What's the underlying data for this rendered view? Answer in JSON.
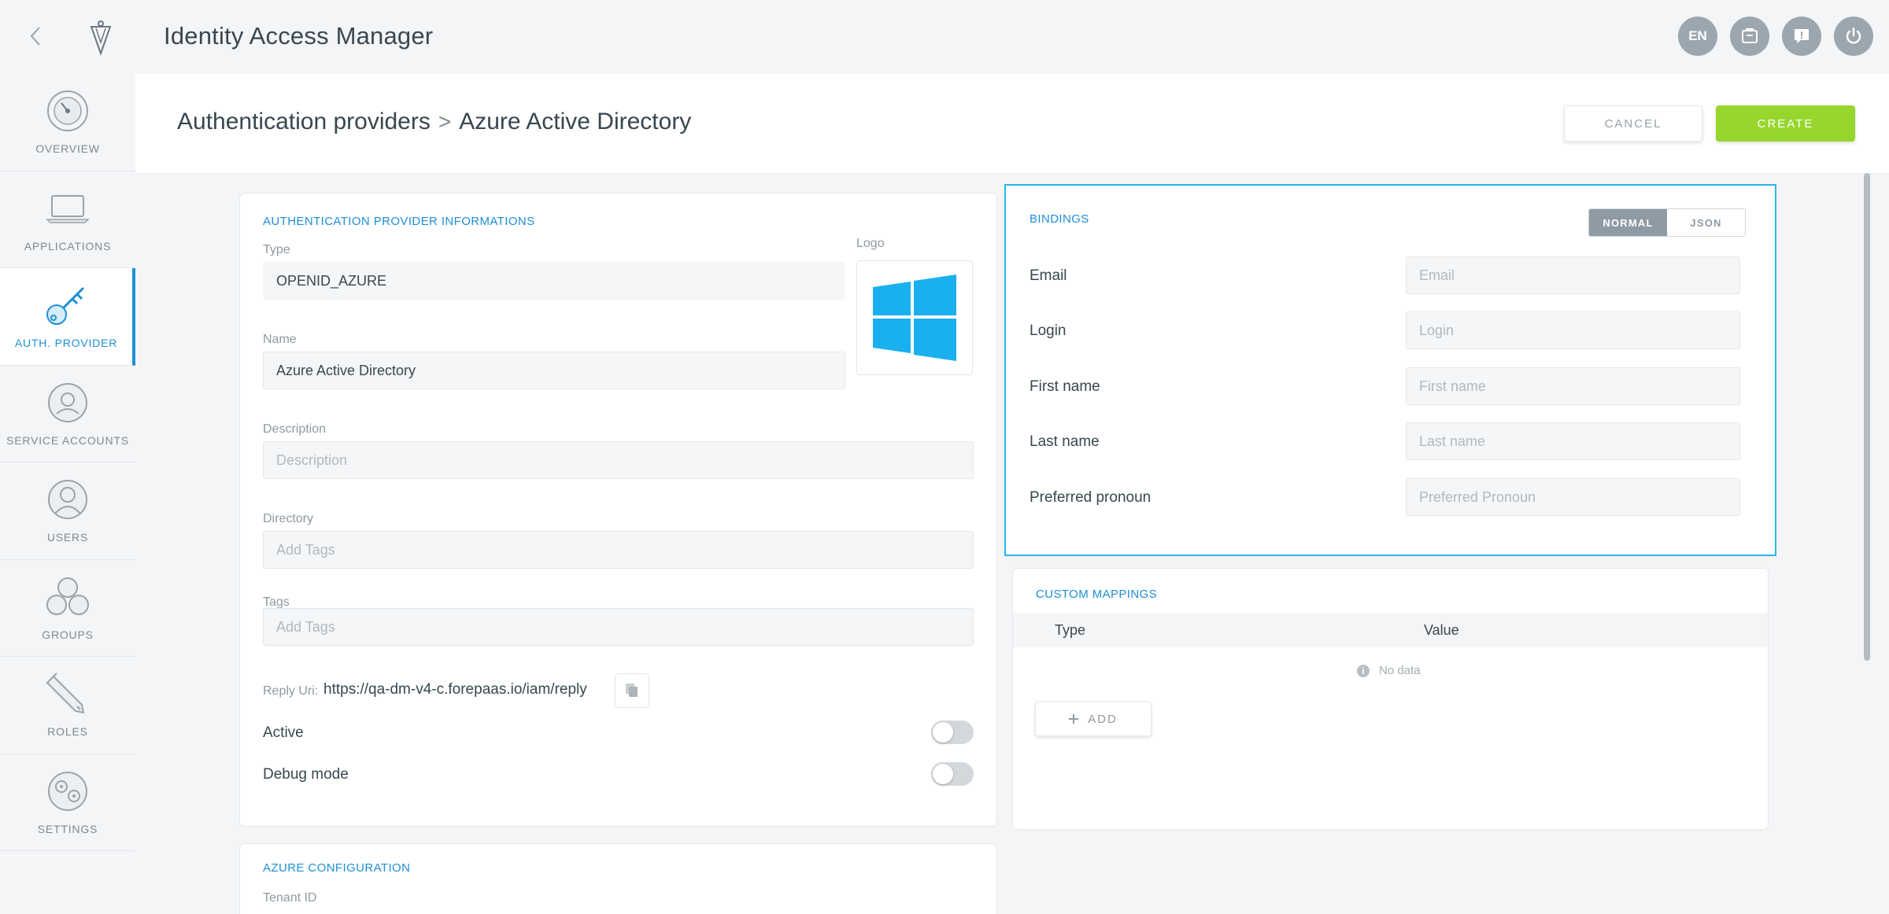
{
  "app": {
    "title": "Identity Access Manager",
    "back_icon": "chevron-left-icon",
    "logo_icon": "forepaas-logo-icon"
  },
  "top_actions": {
    "language": "EN",
    "icons": [
      "store-icon",
      "chat-icon",
      "power-icon"
    ]
  },
  "sidebar": {
    "items": [
      {
        "label": "OVERVIEW",
        "icon": "dashboard-gauge-icon",
        "active": false
      },
      {
        "label": "APPLICATIONS",
        "icon": "laptop-icon",
        "active": false
      },
      {
        "label": "AUTH. PROVIDER",
        "icon": "key-icon",
        "active": true
      },
      {
        "label": "SERVICE ACCOUNTS",
        "icon": "service-accounts-icon",
        "active": false
      },
      {
        "label": "USERS",
        "icon": "user-icon",
        "active": false
      },
      {
        "label": "GROUPS",
        "icon": "groups-icon",
        "active": false
      },
      {
        "label": "ROLES",
        "icon": "pencil-icon",
        "active": false
      },
      {
        "label": "SETTINGS",
        "icon": "settings-icon",
        "active": false
      }
    ],
    "accent_color": "#1e8fd6"
  },
  "header": {
    "breadcrumb_root": "Authentication providers",
    "breadcrumb_separator": ">",
    "breadcrumb_current": "Azure Active Directory",
    "cancel_label": "CANCEL",
    "create_label": "CREATE",
    "create_color": "#97d62d"
  },
  "provider_info": {
    "title": "AUTHENTICATION PROVIDER INFORMATIONS",
    "type_label": "Type",
    "type_value": "OPENID_AZURE",
    "logo_label": "Logo",
    "logo_icon": "windows-logo-icon",
    "name_label": "Name",
    "name_value": "Azure Active Directory",
    "description_label": "Description",
    "description_placeholder": "Description",
    "directory_label": "Directory",
    "directory_placeholder": "Add Tags",
    "tags_label": "Tags",
    "tags_placeholder": "Add Tags",
    "reply_uri_label": "Reply Uri:",
    "reply_uri_value": "https://qa-dm-v4-c.forepaas.io/iam/reply",
    "copy_icon": "copy-icon",
    "active_label": "Active",
    "active_on": false,
    "debug_label": "Debug mode",
    "debug_on": false
  },
  "azure_config": {
    "title": "AZURE CONFIGURATION",
    "tenant_label": "Tenant ID"
  },
  "bindings": {
    "title": "BINDINGS",
    "mode_normal": "NORMAL",
    "mode_json": "JSON",
    "selected_mode": "NORMAL",
    "rows": [
      {
        "label": "Email",
        "placeholder": "Email"
      },
      {
        "label": "Login",
        "placeholder": "Login"
      },
      {
        "label": "First name",
        "placeholder": "First name"
      },
      {
        "label": "Last name",
        "placeholder": "Last name"
      },
      {
        "label": "Preferred pronoun",
        "placeholder": "Preferred Pronoun"
      }
    ],
    "highlight_color": "#29b6e8"
  },
  "custom_mappings": {
    "title": "CUSTOM MAPPINGS",
    "col_type": "Type",
    "col_value": "Value",
    "no_data": "No data",
    "add_label": "ADD",
    "add_icon": "plus-icon",
    "info_icon": "info-icon"
  }
}
